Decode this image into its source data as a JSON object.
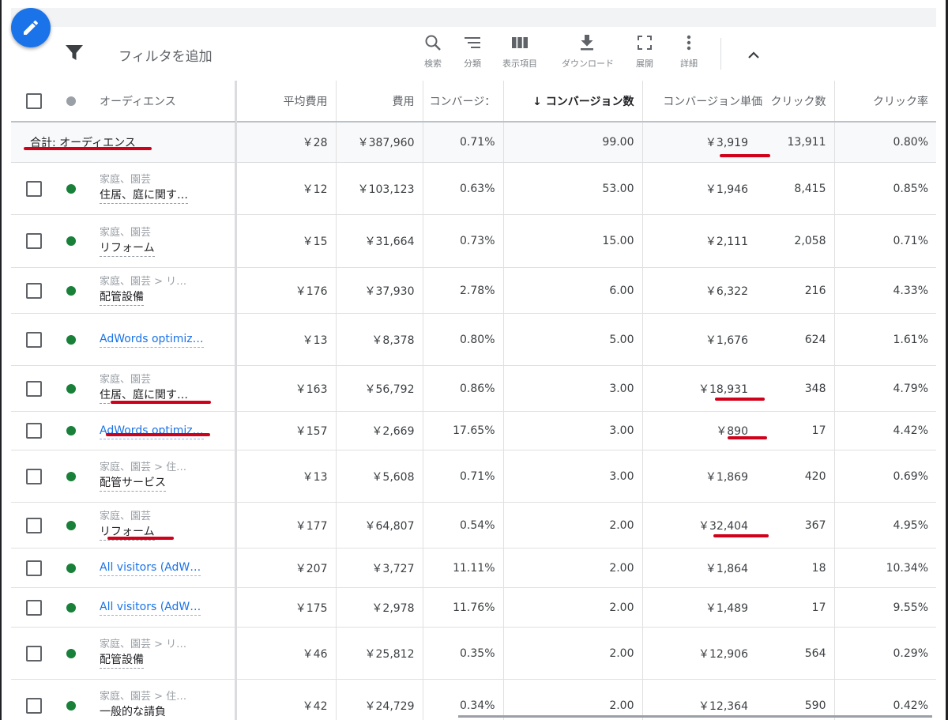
{
  "toolbar": {
    "filter_placeholder": "フィルタを追加",
    "tools": [
      {
        "label": "検索",
        "icon": "search-icon"
      },
      {
        "label": "分類",
        "icon": "segment-icon"
      },
      {
        "label": "表示項目",
        "icon": "columns-icon"
      },
      {
        "label": "ダウンロード",
        "icon": "download-icon"
      },
      {
        "label": "展開",
        "icon": "expand-icon"
      },
      {
        "label": "詳細",
        "icon": "more-icon"
      }
    ]
  },
  "table": {
    "headers": {
      "audience": "オーディエンス",
      "avg_cost": "平均費用",
      "cost": "費用",
      "conv_rate": "コンバージ：",
      "conversions": "コンバージョン数",
      "cost_per_conv": "コンバージョン単価",
      "clicks": "クリック数",
      "ctr": "クリック率"
    },
    "total": {
      "label": "合計: オーディエンス",
      "avg_cost": "￥28",
      "cost": "￥387,960",
      "conv_rate": "0.71%",
      "conversions": "99.00",
      "cost_per_conv": "￥3,919",
      "clicks": "13,911",
      "ctr": "0.80%"
    },
    "rows": [
      {
        "category": "家庭、園芸",
        "name": "住居、庭に関す…",
        "avg_cost": "￥12",
        "cost": "￥103,123",
        "conv_rate": "0.63%",
        "conversions": "53.00",
        "cost_per_conv": "￥1,946",
        "clicks": "8,415",
        "ctr": "0.85%"
      },
      {
        "category": "家庭、園芸",
        "name": "リフォーム",
        "avg_cost": "￥15",
        "cost": "￥31,664",
        "conv_rate": "0.73%",
        "conversions": "15.00",
        "cost_per_conv": "￥2,111",
        "clicks": "2,058",
        "ctr": "0.71%"
      },
      {
        "category": "家庭、園芸 > リ…",
        "name": "配管設備",
        "avg_cost": "￥176",
        "cost": "￥37,930",
        "conv_rate": "2.78%",
        "conversions": "6.00",
        "cost_per_conv": "￥6,322",
        "clicks": "216",
        "ctr": "4.33%"
      },
      {
        "category": "",
        "name": "AdWords optimiz…",
        "avg_cost": "￥13",
        "cost": "￥8,378",
        "conv_rate": "0.80%",
        "conversions": "5.00",
        "cost_per_conv": "￥1,676",
        "clicks": "624",
        "ctr": "1.61%"
      },
      {
        "category": "家庭、園芸",
        "name": "住居、庭に関す…",
        "avg_cost": "￥163",
        "cost": "￥56,792",
        "conv_rate": "0.86%",
        "conversions": "3.00",
        "cost_per_conv": "￥18,931",
        "clicks": "348",
        "ctr": "4.79%"
      },
      {
        "category": "",
        "name": "AdWords optimiz…",
        "avg_cost": "￥157",
        "cost": "￥2,669",
        "conv_rate": "17.65%",
        "conversions": "3.00",
        "cost_per_conv": "￥890",
        "clicks": "17",
        "ctr": "4.42%"
      },
      {
        "category": "家庭、園芸 > 住…",
        "name": "配管サービス",
        "avg_cost": "￥13",
        "cost": "￥5,608",
        "conv_rate": "0.71%",
        "conversions": "3.00",
        "cost_per_conv": "￥1,869",
        "clicks": "420",
        "ctr": "0.69%"
      },
      {
        "category": "家庭、園芸",
        "name": "リフォーム",
        "avg_cost": "￥177",
        "cost": "￥64,807",
        "conv_rate": "0.54%",
        "conversions": "2.00",
        "cost_per_conv": "￥32,404",
        "clicks": "367",
        "ctr": "4.95%"
      },
      {
        "category": "",
        "name": "All visitors (AdW…",
        "avg_cost": "￥207",
        "cost": "￥3,727",
        "conv_rate": "11.11%",
        "conversions": "2.00",
        "cost_per_conv": "￥1,864",
        "clicks": "18",
        "ctr": "10.34%"
      },
      {
        "category": "",
        "name": "All visitors (AdW…",
        "avg_cost": "￥175",
        "cost": "￥2,978",
        "conv_rate": "11.76%",
        "conversions": "2.00",
        "cost_per_conv": "￥1,489",
        "clicks": "17",
        "ctr": "9.55%"
      },
      {
        "category": "家庭、園芸 > リ…",
        "name": "配管設備",
        "avg_cost": "￥46",
        "cost": "￥25,812",
        "conv_rate": "0.35%",
        "conversions": "2.00",
        "cost_per_conv": "￥12,906",
        "clicks": "564",
        "ctr": "0.29%"
      },
      {
        "category": "家庭、園芸 > 住…",
        "name": "一般的な請負",
        "avg_cost": "￥42",
        "cost": "￥24,729",
        "conv_rate": "0.34%",
        "conversions": "2.00",
        "cost_per_conv": "￥12,364",
        "clicks": "590",
        "ctr": "0.42%"
      }
    ]
  },
  "colors": {
    "accent": "#1a73e8",
    "status_enabled": "#188038",
    "annotation": "#d0021b"
  }
}
